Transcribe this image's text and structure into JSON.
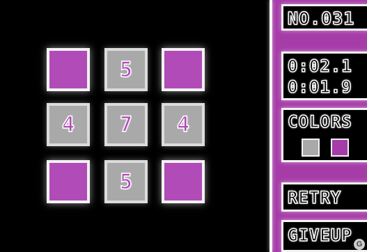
{
  "hud": {
    "puzzle_number": "NO.031",
    "time_current": "0:02.1",
    "time_best": "0:01.9",
    "colors_label": "COLORS",
    "colors": [
      "#a9a9a9",
      "#a63ca8"
    ],
    "retry_label": "RETRY",
    "giveup_label": "GIVEUP",
    "watermark": "G"
  },
  "board": {
    "rows": [
      [
        {
          "color": "purple",
          "number": ""
        },
        {
          "color": "gray",
          "number": "5"
        },
        {
          "color": "purple",
          "number": ""
        }
      ],
      [
        {
          "color": "gray",
          "number": "4"
        },
        {
          "color": "gray",
          "number": "7"
        },
        {
          "color": "gray",
          "number": "4"
        }
      ],
      [
        {
          "color": "purple",
          "number": ""
        },
        {
          "color": "gray",
          "number": "5"
        },
        {
          "color": "purple",
          "number": ""
        }
      ]
    ]
  },
  "palette": {
    "purple": "#b04bb8",
    "gray": "#a9a9a9",
    "panel": "#a63ca8",
    "border": "#f2f2f2"
  }
}
